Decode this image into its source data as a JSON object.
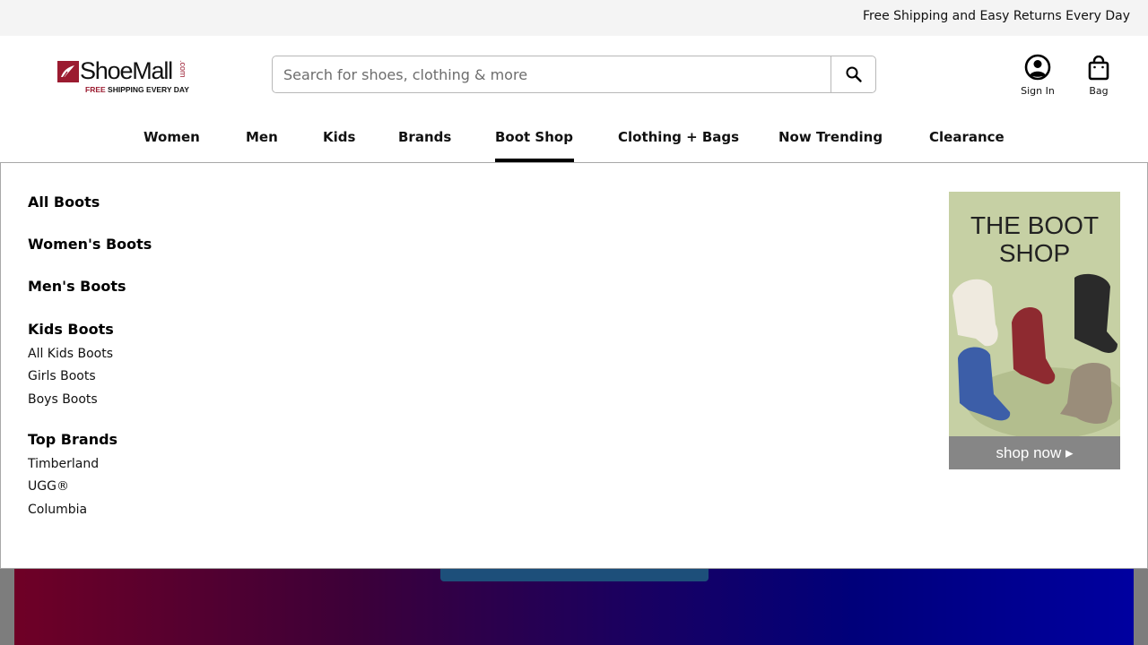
{
  "promo_bar": {
    "text": "Free Shipping and Easy Returns Every Day"
  },
  "logo": {
    "name": "ShoeMall",
    "suffix": ".com",
    "tagline_red": "FREE",
    "tagline": "SHIPPING EVERY DAY"
  },
  "search": {
    "placeholder": "Search for shoes, clothing & more",
    "value": "",
    "button_icon": "search-icon"
  },
  "account": {
    "label": "Sign In",
    "icon": "user-circle-icon"
  },
  "bag": {
    "label": "Bag",
    "icon": "shopping-bag-icon"
  },
  "nav": {
    "active": "Boot Shop",
    "items": [
      {
        "label": "Women"
      },
      {
        "label": "Men"
      },
      {
        "label": "Kids"
      },
      {
        "label": "Brands"
      },
      {
        "label": "Boot Shop"
      },
      {
        "label": "Clothing + Bags"
      },
      {
        "label": "Now Trending"
      },
      {
        "label": "Clearance"
      }
    ]
  },
  "mega_menu": {
    "all_boots": "All Boots",
    "womens_boots": "Women's Boots",
    "mens_boots": "Men's Boots",
    "kids_boots": {
      "heading": "Kids Boots",
      "links": [
        "All Kids Boots",
        "Girls Boots",
        "Boys Boots"
      ]
    },
    "top_brands": {
      "heading": "Top Brands",
      "links": [
        "Timberland",
        "UGG®",
        "Columbia"
      ]
    },
    "promo": {
      "title_line1": "THE BOOT",
      "title_line2": "SHOP",
      "cta": "shop now ▸"
    }
  },
  "colors": {
    "brand": "#9b1b30",
    "promo_bar_bg": "#f4f4f4",
    "promo_card_bg": "#c6d0a4",
    "cta_bg": "#868686"
  }
}
